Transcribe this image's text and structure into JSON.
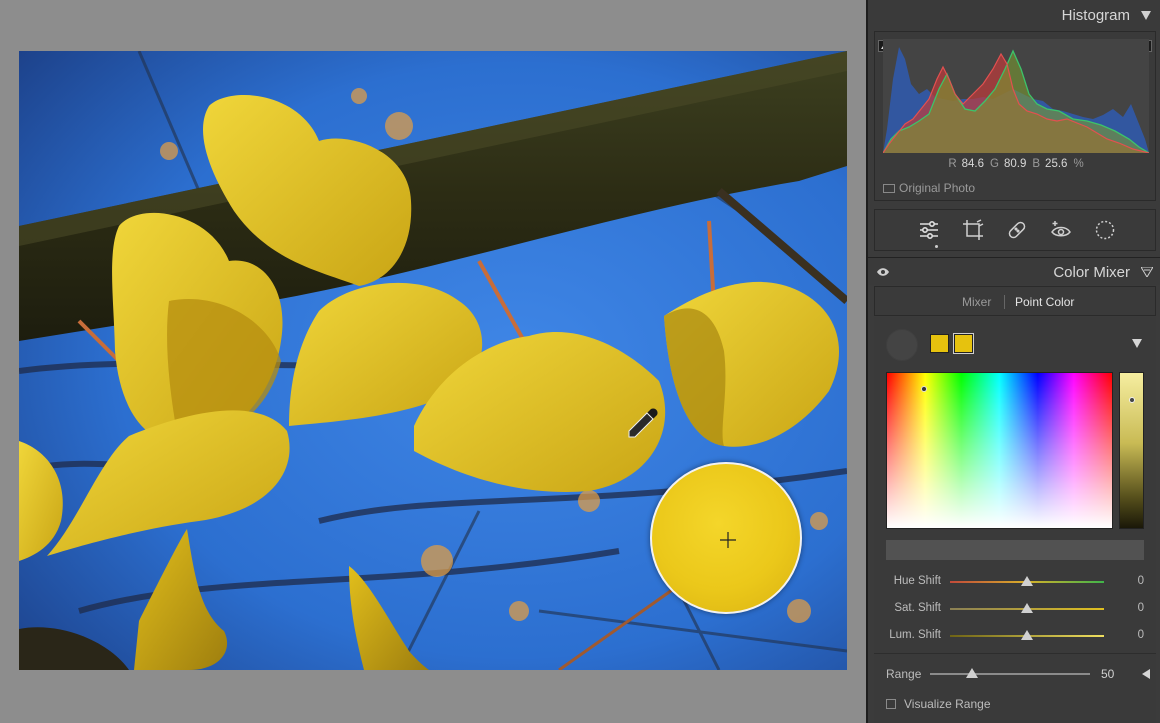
{
  "histogram": {
    "title": "Histogram",
    "readout": {
      "r_label": "R",
      "r_value": "84.6",
      "g_label": "G",
      "g_value": "80.9",
      "b_label": "B",
      "b_value": "25.6",
      "unit": "%"
    },
    "original_photo_label": "Original Photo"
  },
  "tools": {
    "icons": [
      "edit-sliders-icon",
      "crop-icon",
      "healing-icon",
      "redeye-icon",
      "masking-icon"
    ],
    "active": "edit-sliders-icon"
  },
  "color_mixer": {
    "title": "Color Mixer",
    "tabs": {
      "mixer": "Mixer",
      "point_color": "Point Color",
      "active": "Point Color"
    },
    "swatch_color": "#e6c20e",
    "adjustments": [
      {
        "label": "Hue Shift",
        "value": "0"
      },
      {
        "label": "Sat. Shift",
        "value": "0"
      },
      {
        "label": "Lum. Shift",
        "value": "0"
      }
    ],
    "range": {
      "label": "Range",
      "value": "50"
    },
    "visualize_range": {
      "label": "Visualize Range",
      "checked": false
    }
  }
}
